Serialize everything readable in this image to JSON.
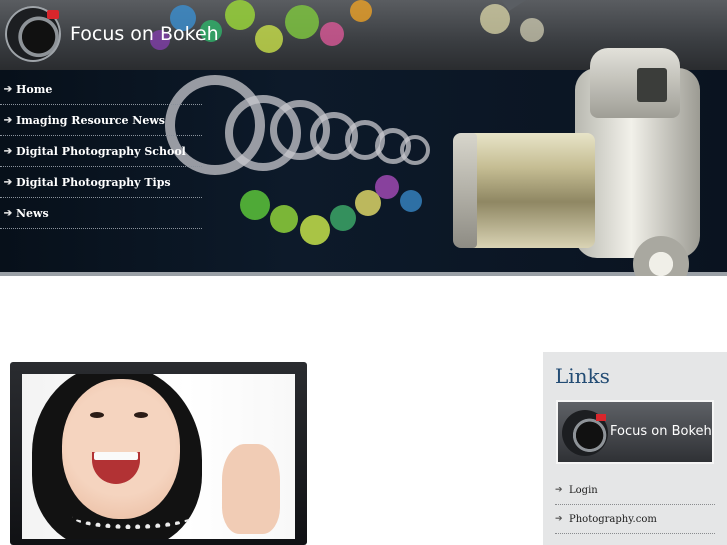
{
  "site": {
    "title": "Focus on Bokeh"
  },
  "nav": {
    "items": [
      {
        "label": "Home"
      },
      {
        "label": "Imaging Resource News"
      },
      {
        "label": "Digital Photography School"
      },
      {
        "label": "Digital Photography Tips"
      },
      {
        "label": "News"
      }
    ],
    "arrow_icon": "arrow-right-icon"
  },
  "sidebar": {
    "title": "Links",
    "logo_text": "Focus on Bokeh",
    "links": [
      {
        "label": "Login"
      },
      {
        "label": "Photography.com"
      }
    ]
  },
  "colors": {
    "accent_red": "#d8262c",
    "links_title": "#234c74",
    "header_dark": "#0b121c",
    "sidebar_bg": "#e5e6e7"
  }
}
